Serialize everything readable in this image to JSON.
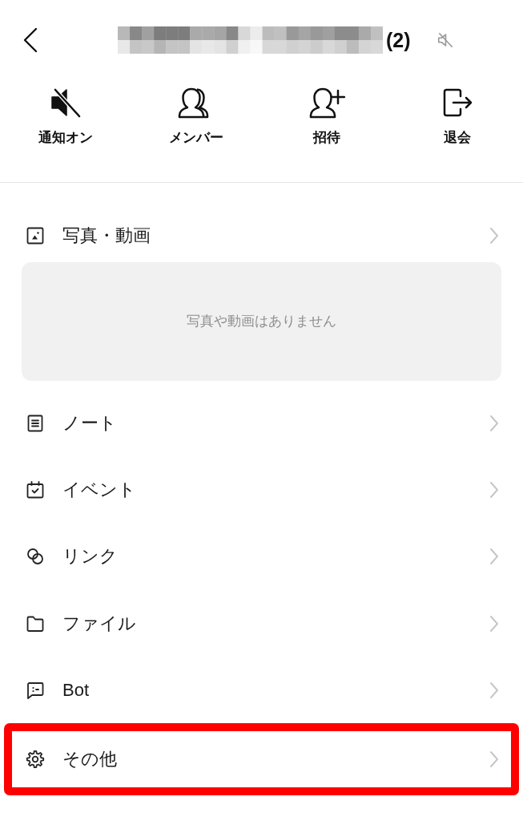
{
  "header": {
    "count": "(2)",
    "muted": true
  },
  "actions": [
    {
      "kind": "mute",
      "label": "通知オン"
    },
    {
      "kind": "members",
      "label": "メンバー"
    },
    {
      "kind": "invite",
      "label": "招待"
    },
    {
      "kind": "leave",
      "label": "退会"
    }
  ],
  "media": {
    "label": "写真・動画",
    "empty_text": "写真や動画はありません"
  },
  "items": [
    {
      "kind": "note",
      "label": "ノート",
      "highlighted": false
    },
    {
      "kind": "event",
      "label": "イベント",
      "highlighted": false
    },
    {
      "kind": "link",
      "label": "リンク",
      "highlighted": false
    },
    {
      "kind": "file",
      "label": "ファイル",
      "highlighted": false
    },
    {
      "kind": "bot",
      "label": "Bot",
      "highlighted": false
    },
    {
      "kind": "other",
      "label": "その他",
      "highlighted": true
    }
  ]
}
